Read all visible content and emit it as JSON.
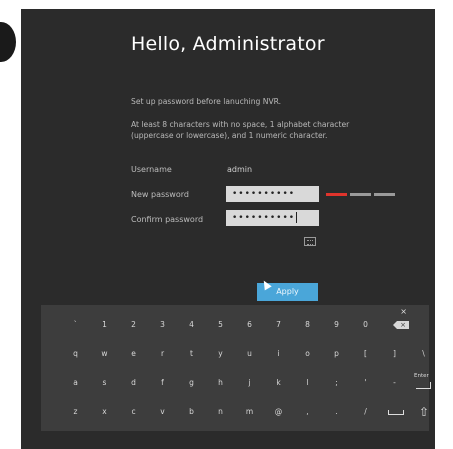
{
  "title": "Hello, Administrator",
  "intro": "Set up password before lanuching NVR.",
  "rule_line1": "At least 8 characters with no space, 1 alphabet character",
  "rule_line2": "(uppercase or lowercase), and 1 numeric character.",
  "form": {
    "username_label": "Username",
    "username_value": "admin",
    "new_password_label": "New password",
    "new_password_value": "••••••••••",
    "confirm_password_label": "Confirm password",
    "confirm_password_value": "••••••••••",
    "strength_colors": [
      "#e0342c",
      "#9a9a9a",
      "#9a9a9a"
    ]
  },
  "apply_label": "Apply",
  "keyboard": {
    "close": "×",
    "row1": [
      "`",
      "1",
      "2",
      "3",
      "4",
      "5",
      "6",
      "7",
      "8",
      "9",
      "0"
    ],
    "row2": [
      "q",
      "w",
      "e",
      "r",
      "t",
      "y",
      "u",
      "i",
      "o",
      "p",
      "[",
      "]",
      "\\"
    ],
    "row3": [
      "a",
      "s",
      "d",
      "f",
      "g",
      "h",
      "j",
      "k",
      "l",
      ";",
      "'",
      "-"
    ],
    "row4": [
      "z",
      "x",
      "c",
      "v",
      "b",
      "n",
      "m",
      "@",
      ",",
      ".",
      "/"
    ],
    "enter_label": "Enter"
  }
}
